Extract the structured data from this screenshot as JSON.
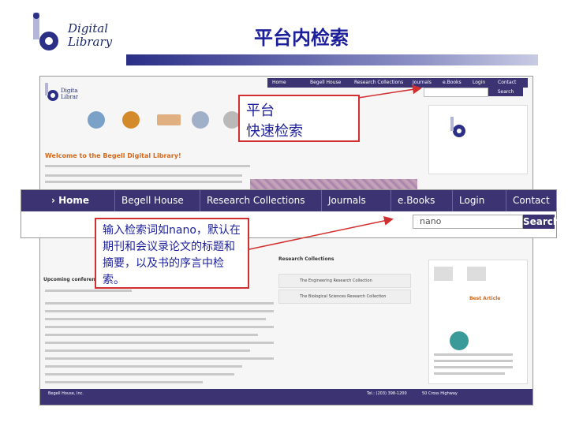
{
  "slide": {
    "title": "平台内检索",
    "logo_line1": "Digital",
    "logo_line2": "Library"
  },
  "callouts": {
    "platform_line1": "平台",
    "platform_line2": "快速检索",
    "nano_text": "输入检索词如nano，默认在期刊和会议录论文的标题和摘要，以及书的序言中检索。"
  },
  "nav": {
    "items": [
      "Home",
      "Begell House",
      "Research Collections",
      "Journals",
      "e.Books",
      "Login",
      "Contact"
    ],
    "search_value": "nano",
    "search_button": "Search"
  },
  "site": {
    "welcome": "Welcome to the Begell Digital Library!",
    "research_collections": "Research Collections",
    "rc_items": [
      "The Engineering Research Collection",
      "The Biological Sciences Research Collection"
    ],
    "upcoming": "Upcoming conferences",
    "best_article": "Best Article",
    "footer_left": "Begell House, Inc.",
    "footer_tel": "Tel.: (203) 398-1200",
    "footer_addr": "50 Cross Highway"
  },
  "colors": {
    "title": "#1b1f9a",
    "nav": "#3c3472",
    "callout_border": "#d23030"
  }
}
